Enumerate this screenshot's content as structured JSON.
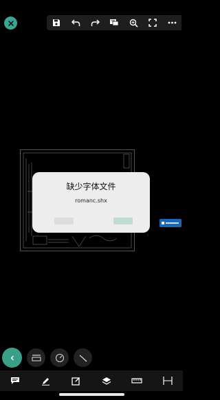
{
  "dialog": {
    "title": "缺少字体文件",
    "message": "romanc.shx"
  },
  "colors": {
    "accent": "#3aa68f",
    "toolbar_bg": "#1e1e1e",
    "dialog_bg": "#ededed",
    "background": "#000000"
  },
  "toolbar": {
    "icons": [
      "save-icon",
      "undo-icon",
      "redo-icon",
      "comment-icon",
      "zoom-icon",
      "fullscreen-icon",
      "more-icon"
    ]
  },
  "fabs": [
    "collapse-icon",
    "measure-icon",
    "circle-measure-icon",
    "line-icon"
  ],
  "bottom_bar": {
    "icons": [
      "annotation-icon",
      "pen-icon",
      "edit-icon",
      "layers-icon",
      "ruler-icon",
      "dimension-icon"
    ]
  }
}
